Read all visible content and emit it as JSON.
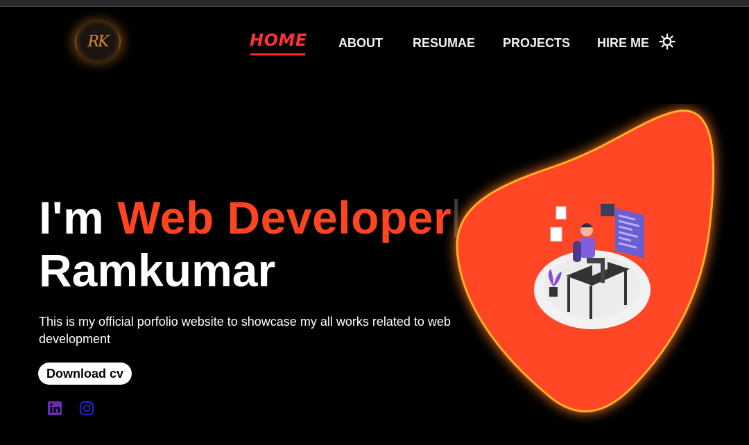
{
  "brand": {
    "logo_text": "RK",
    "logo_icon": "rk-logo"
  },
  "nav": {
    "items": [
      {
        "label": "HOME",
        "active": true
      },
      {
        "label": "ABOUT"
      },
      {
        "label": "RESUMAE"
      },
      {
        "label": "PROJECTS"
      },
      {
        "label": "HIRE ME"
      }
    ],
    "theme_toggle_icon": "sun-icon"
  },
  "hero": {
    "prefix": "I'm ",
    "role": "Web Developer",
    "name": "Ramkumar",
    "description": "This is my official porfolio website to showcase my all works related to web development",
    "cta_label": "Download cv"
  },
  "social": [
    {
      "icon": "linkedin-icon",
      "color": "#6a2bb5"
    },
    {
      "icon": "instagram-icon",
      "color": "#2020c8"
    }
  ],
  "colors": {
    "accent": "#ff4422",
    "nav_active": "#ff2a2a",
    "background": "#000000",
    "blob": "#ff4626",
    "blob_glow": "#ffb020"
  },
  "illustration": {
    "icon": "developer-at-desk-illustration"
  }
}
